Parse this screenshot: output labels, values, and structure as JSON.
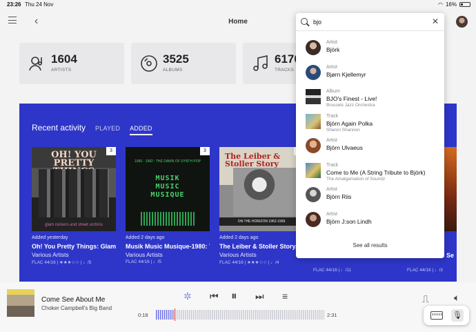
{
  "status": {
    "time": "23:26",
    "date": "Thu 24 Nov",
    "battery": "16%"
  },
  "topbar": {
    "title": "Home"
  },
  "stats": [
    {
      "value": "1604",
      "label": "ARTISTS"
    },
    {
      "value": "3525",
      "label": "ALBUMS"
    },
    {
      "value": "6170",
      "label": "TRACKS"
    }
  ],
  "recent": {
    "heading": "Recent activity",
    "tabs": [
      "PLAYED",
      "ADDED"
    ],
    "active_tab": "ADDED",
    "cards": [
      {
        "badge": "3",
        "cover_title": "OH! YOU PRETTY THINGS",
        "cover_bottom": "glam rockers and street urchins",
        "added": "Added yesterday",
        "name": "Oh! You Pretty Things: Glam C",
        "artist": "Various Artists",
        "meta": "FLAC 44/16 | ★★★☆☆ | ♩/5"
      },
      {
        "badge": "3",
        "cover_sub": "1966 - 1982 : THE DAWN OF SYNTH POP",
        "cover_title_1": "MUSIK",
        "cover_title_2": "MUSIC",
        "cover_title_3": "MUSIQUE",
        "added": "Added 2 days ago",
        "name": "Musik Music Musique-1980: T",
        "artist": "Various Artists",
        "meta": "FLAC 44/16 | ♩/5"
      },
      {
        "badge": "3",
        "cover_title_1": "The Leiber &",
        "cover_title_2": "Stoller Story",
        "cover_strip": "ON THE HORIZON 1962-1969",
        "added": "Added 2 days ago",
        "name": "The Leiber & Stoller Story, V",
        "artist": "Various Artists",
        "meta": "FLAC 44/16 | ★★★☆☆ | ♩/4"
      }
    ],
    "hidden_meta_4": "FLAC 44/16 | ♩/11",
    "hidden_meta_5": "FLAC 44/16 | ♩/3",
    "hidden_name_5": "DJ Se"
  },
  "search": {
    "query": "bjo",
    "results": [
      {
        "type": "Artist",
        "name": "Björk",
        "sub": ""
      },
      {
        "type": "Artist",
        "name": "Bjørn Kjellemyr",
        "sub": ""
      },
      {
        "type": "Album",
        "name": "BJO's Finest - Live!",
        "sub": "Brussels Jazz Orchestra"
      },
      {
        "type": "Track",
        "name": "Björn Again Polka",
        "sub": "Sharon Shannon"
      },
      {
        "type": "Artist",
        "name": "Björn Ulvaeus",
        "sub": ""
      },
      {
        "type": "Track",
        "name": "Come to Me (A String Tribute to Björk)",
        "sub": "The Amalgamation of Soundz"
      },
      {
        "type": "Artist",
        "name": "Björn Riis",
        "sub": ""
      },
      {
        "type": "Artist",
        "name": "Björn J:son Lindh",
        "sub": ""
      }
    ],
    "see_all": "See all results"
  },
  "player": {
    "title": "Come See About Me",
    "artist": "Choker Campbell's Big Band",
    "elapsed": "0:18",
    "duration": "2:31",
    "progress_fraction": 0.11
  }
}
